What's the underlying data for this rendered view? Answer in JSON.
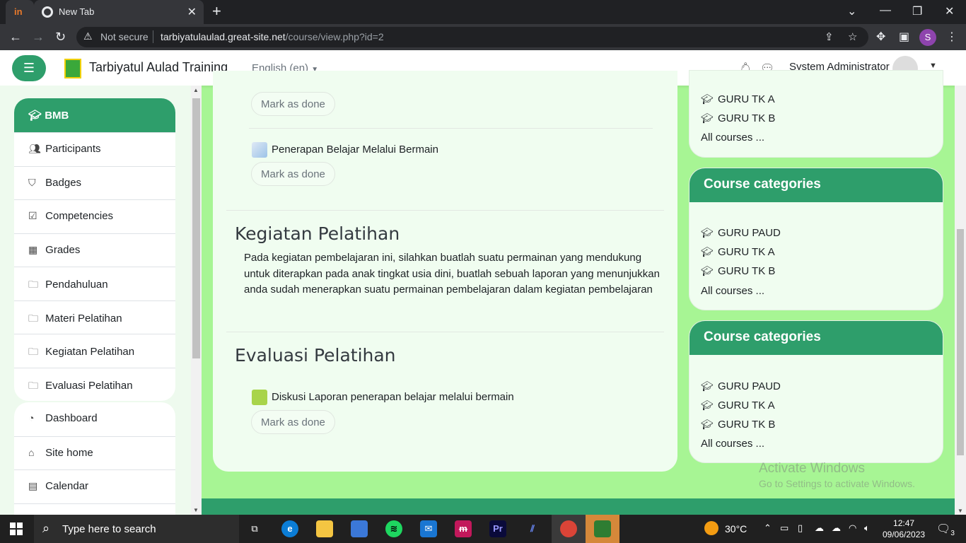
{
  "browser": {
    "tab_title": "New Tab",
    "not_secure": "Not secure",
    "url_host": "tarbiyatulaulad.great-site.net",
    "url_path": "/course/view.php?id=2",
    "profile_initial": "S"
  },
  "header": {
    "site_name": "Tarbiyatul Aulad Training",
    "language": "English (en)",
    "user_name": "System Administrator"
  },
  "drawer": {
    "course_title": "BMB",
    "course_items": [
      {
        "label": "Participants",
        "icon": "users-icon"
      },
      {
        "label": "Badges",
        "icon": "shield-icon"
      },
      {
        "label": "Competencies",
        "icon": "checkbox-icon"
      },
      {
        "label": "Grades",
        "icon": "table-icon"
      },
      {
        "label": "Pendahuluan",
        "icon": "folder-icon"
      },
      {
        "label": "Materi Pelatihan",
        "icon": "folder-icon"
      },
      {
        "label": "Kegiatan Pelatihan",
        "icon": "folder-icon"
      },
      {
        "label": "Evaluasi Pelatihan",
        "icon": "folder-icon"
      }
    ],
    "site_items": [
      {
        "label": "Dashboard",
        "icon": "dashboard-icon"
      },
      {
        "label": "Site home",
        "icon": "home-icon"
      },
      {
        "label": "Calendar",
        "icon": "calendar-icon"
      }
    ]
  },
  "main": {
    "mark_done_label": "Mark as done",
    "activity_url": "Penerapan Belajar Melalui Bermain",
    "section_kegiatan_title": "Kegiatan Pelatihan",
    "section_kegiatan_desc": "Pada kegiatan pembelajaran ini, silahkan buatlah suatu permainan yang mendukung untuk diterapkan pada anak tingkat usia dini, buatlah sebuah laporan yang menunjukkan anda sudah menerapkan suatu permainan pembelajaran dalam kegiatan pembelajaran",
    "section_evaluasi_title": "Evaluasi Pelatihan",
    "activity_forum": "Diskusi Laporan penerapan belajar melalui bermain"
  },
  "blocks": {
    "title": "Course categories",
    "categories": [
      "GURU PAUD",
      "GURU TK A",
      "GURU TK B"
    ],
    "all_courses": "All courses ..."
  },
  "watermark": {
    "line1": "Activate Windows",
    "line2": "Go to Settings to activate Windows."
  },
  "taskbar": {
    "search_placeholder": "Type here to search",
    "temperature": "30°C",
    "time": "12:47",
    "date": "09/06/2023",
    "notification_count": "3"
  }
}
